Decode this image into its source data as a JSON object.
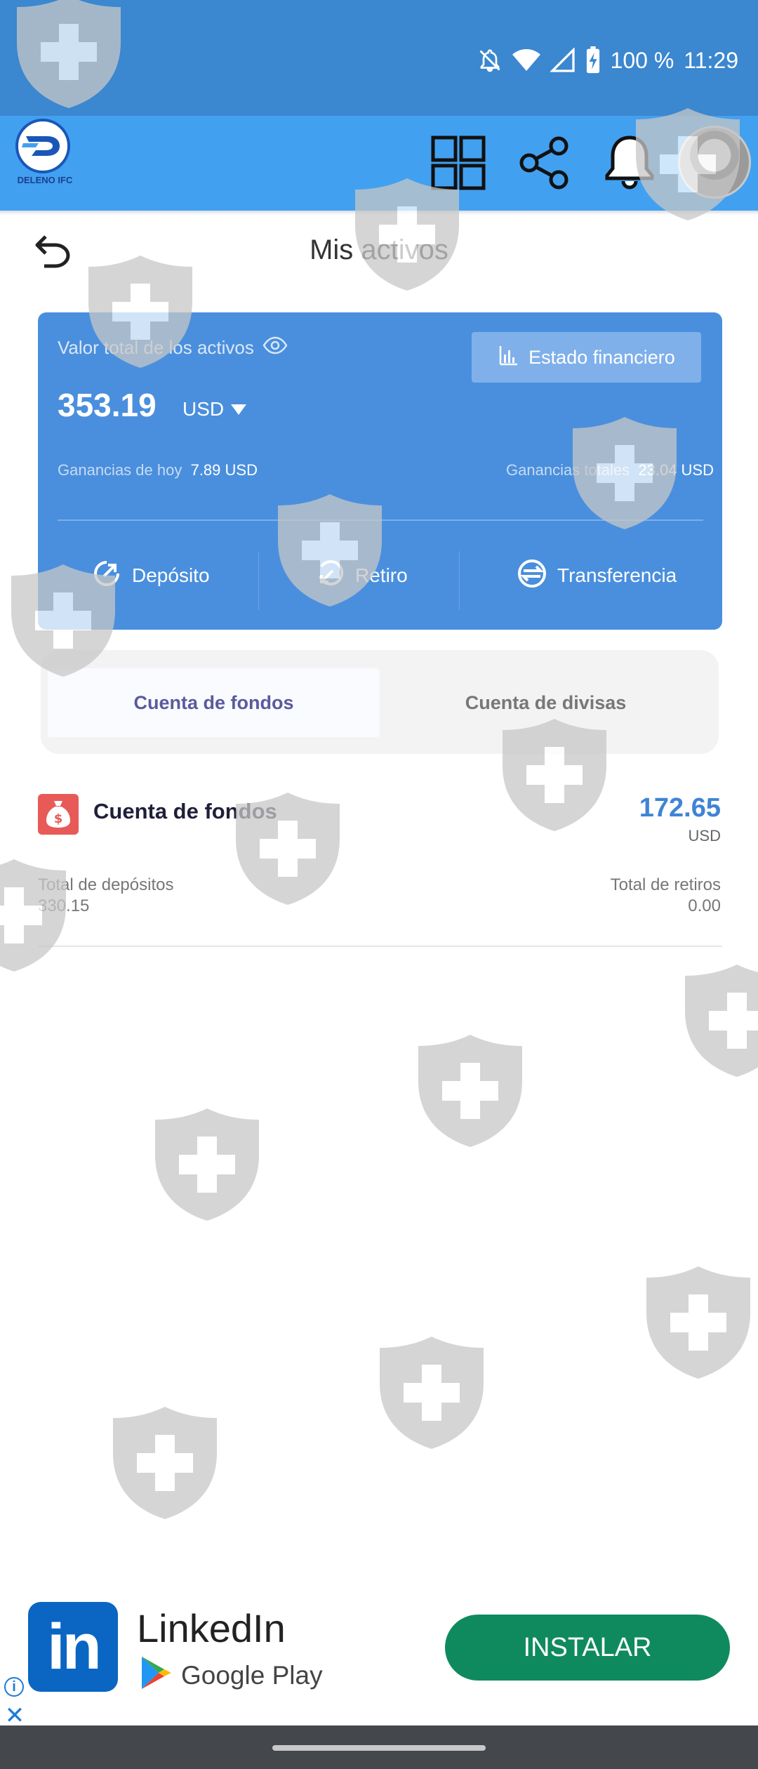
{
  "status_bar": {
    "battery": "100 %",
    "time": "11:29",
    "icons": [
      "notifications-off-icon",
      "wifi-icon",
      "signal-icon",
      "battery-charging-icon"
    ]
  },
  "header": {
    "logo_text": "DELENO IFC",
    "icons": [
      "grid-icon",
      "share-icon",
      "bell-icon"
    ]
  },
  "page": {
    "title": "Mis activos"
  },
  "asset_card": {
    "label": "Valor total de los activos",
    "financial_button": "Estado financiero",
    "balance": "353.19",
    "currency": "USD",
    "today_label": "Ganancias de hoy",
    "today_value": "7.89 USD",
    "total_label": "Ganancias totales",
    "total_value": "23.04 USD",
    "actions": {
      "deposit": "Depósito",
      "withdraw": "Retiro",
      "transfer": "Transferencia"
    }
  },
  "tabs": {
    "active": "Cuenta de fondos",
    "inactive": "Cuenta de divisas"
  },
  "fund_account": {
    "title": "Cuenta de fondos",
    "amount": "172.65",
    "unit": "USD",
    "deposits_label": "Total de depósitos",
    "deposits_value": "330.15",
    "withdrawals_label": "Total de retiros",
    "withdrawals_value": "0.00"
  },
  "ad": {
    "logo": "in",
    "title": "LinkedIn",
    "store": "Google Play",
    "button": "INSTALAR"
  },
  "colors": {
    "status_bar": "#3b87d0",
    "header": "#42a0f0",
    "card": "#4a8fdd",
    "accent": "#3f84d6",
    "install_button": "#0f8a5f"
  }
}
